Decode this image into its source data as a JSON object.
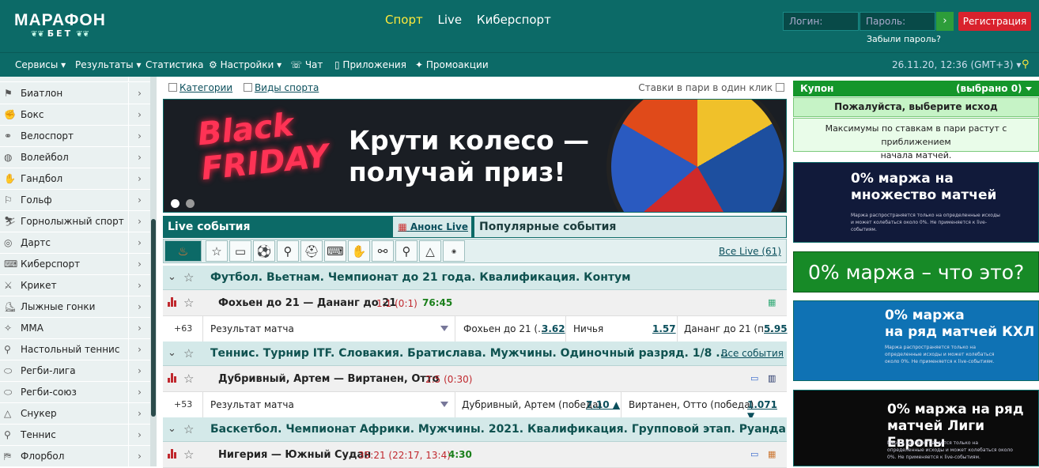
{
  "brand": {
    "name": "МАРАФОН",
    "sub": "БЕТ"
  },
  "nav": [
    "Спорт",
    "Live",
    "Киберспорт"
  ],
  "auth": {
    "login": "Логин:",
    "password": "Пароль:",
    "go": "›",
    "register": "Регистрация",
    "forgot": "Забыли пароль?"
  },
  "menu": {
    "items": [
      "Сервисы ▾",
      "Результаты ▾",
      "Статистика",
      "⚙ Настройки ▾",
      "☏ Чат",
      "▯ Приложения",
      "✦ Промоакции"
    ],
    "datetime": "26.11.20, 12:36 (GMT+3) ▾"
  },
  "sports": [
    "Биатлон",
    "Бокс",
    "Велоспорт",
    "Волейбол",
    "Гандбол",
    "Гольф",
    "Горнолыжный спорт",
    "Дартс",
    "Киберспорт",
    "Крикет",
    "Лыжные гонки",
    "ММА",
    "Настольный теннис",
    "Регби-лига",
    "Регби-союз",
    "Снукер",
    "Теннис",
    "Флорбол"
  ],
  "filters": {
    "categories": "Категории",
    "sports": "Виды спорта",
    "oneclick": "Ставки в пари в один клик"
  },
  "banner": {
    "title1": "Black",
    "title2": "FRIDAY",
    "text1": "Крути колесо —",
    "text2": "получай приз!"
  },
  "live": {
    "tab": "Live события",
    "announce": "Анонс Live",
    "popular": "Популярные события",
    "all_live": "Все Live (61)"
  },
  "events": [
    {
      "league": "Футбол. Вьетнам. Чемпионат до 21 года. Квалификация. Контум",
      "match": "Фохьен до 21 — Дананг до 21",
      "score": "1:1 (0:1)",
      "time": "76:45",
      "plus": "+63",
      "market": "Результат матча",
      "o1": "Фохьен до 21 (...",
      "v1": "3.62",
      "o2": "Ничья",
      "v2": "1.57",
      "o3": "Дананг до 21 (п...",
      "v3": "5.95"
    },
    {
      "league": "Теннис. Турнир ITF. Словакия. Братислава. Мужчины. Одиночный разряд. 1/8 ...",
      "all": "Все события",
      "match": "Дубривный, Артем — Виртанен, Отто",
      "score": "2:5 (0:30)",
      "plus": "+53",
      "market": "Результат матча",
      "o1": "Дубривный, Артем (победа)",
      "v1": "7.10 ▲",
      "o2": "Виртанен, Отто (победа)",
      "v2": "1.071 ▼"
    },
    {
      "league": "Баскетбол. Чемпионат Африки. Мужчины. 2021. Квалификация. Групповой этап. Руанда",
      "match": "Нигерия — Южный Судан",
      "score": "35:21 (22:17, 13:4)",
      "time": "4:30"
    }
  ],
  "coupon": {
    "title": "Купон",
    "selected": "(выбрано 0)",
    "choose": "Пожалуйста, выберите исход",
    "note1": "Максимумы по ставкам в пари растут с приближением",
    "note2": "начала матчей."
  },
  "promos": [
    {
      "h1": "0% маржа на",
      "h2": "множество матчей",
      "small": "Маржа распространяется только на определенные исходы и может колебаться около 0%. Не применяется к live-событиям."
    },
    {
      "h1": "0% маржа – что это?"
    },
    {
      "h1": "0% маржа",
      "h2": "на ряд матчей КХЛ",
      "small": "Маржа распространяется только на определенные исходы и может колебаться около 0%. Не применяется к live-событиям."
    },
    {
      "h1": "0% маржа на ряд",
      "h2": "матчей Лиги Европы",
      "small": "Маржа распространяется только на определенные исходы и может колебаться около 0%. Не применяется к live-событиям."
    }
  ]
}
